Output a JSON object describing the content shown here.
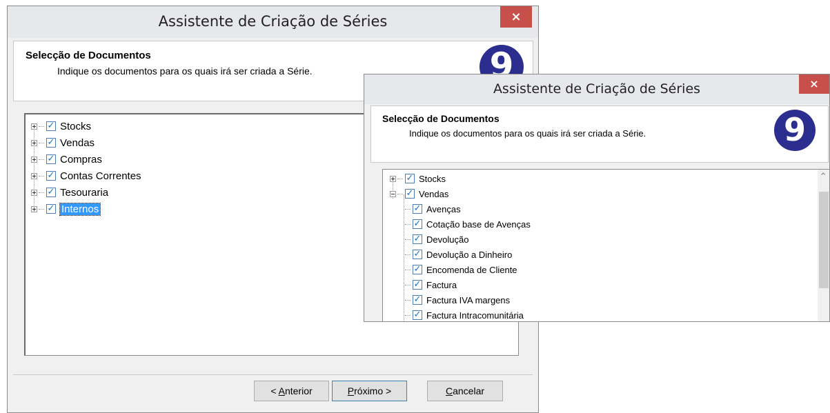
{
  "back_window": {
    "title": "Assistente de Criação de Séries",
    "close_label": "×",
    "header_title": "Selecção de Documentos",
    "header_subtitle": "Indique os documentos para os quais irá ser criada a Série.",
    "logo_text": "9",
    "tree": [
      {
        "label": "Stocks",
        "checked": true
      },
      {
        "label": "Vendas",
        "checked": true
      },
      {
        "label": "Compras",
        "checked": true
      },
      {
        "label": "Contas Correntes",
        "checked": true
      },
      {
        "label": "Tesouraria",
        "checked": true
      },
      {
        "label": "Internos",
        "checked": true,
        "selected": true
      }
    ],
    "buttons": {
      "back_mn": "A",
      "back_rest": "nterior",
      "back_prefix": "< ",
      "next_mn": "P",
      "next_rest": "róximo >",
      "cancel_mn": "C",
      "cancel_rest": "ancelar"
    }
  },
  "front_window": {
    "title": "Assistente de Criação de Séries",
    "close_label": "×",
    "header_title": "Selecção de Documentos",
    "header_subtitle": "Indique os documentos para os quais irá ser criada a Série.",
    "logo_text": "9",
    "tree": {
      "stocks": "Stocks",
      "vendas": "Vendas",
      "children": [
        "Avenças",
        "Cotação base de Avenças",
        "Devolução",
        "Devolução a Dinheiro",
        "Encomenda de Cliente",
        "Factura",
        "Factura IVA margens",
        "Factura Intracomunitária"
      ]
    },
    "scroll_up_icon": "^"
  },
  "colors": {
    "close_button": "#c7504a",
    "logo": "#2b2d8f",
    "selection": "#3399ff",
    "checkmark": "#1a73c6"
  }
}
